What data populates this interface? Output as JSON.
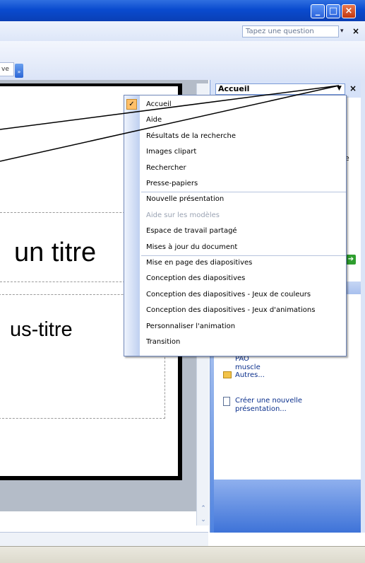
{
  "window": {
    "controls": {
      "minimize_icon": "_",
      "maximize_icon": "□",
      "close_icon": "×"
    }
  },
  "menubar": {
    "help_placeholder": "Tapez une question",
    "help_dropdown_icon": "▾",
    "close_icon": "×"
  },
  "toolbar": {
    "fragment_label": "ve",
    "overflow_icon": "»"
  },
  "slide": {
    "title_placeholder_fragment": "un titre",
    "subtitle_placeholder_fragment": "us-titre"
  },
  "scrollbar": {
    "up_icon": "⌃",
    "down_icon": "⌄"
  },
  "taskpane": {
    "title": "Accueil",
    "dropdown_icon": "▼",
    "close_icon": "×",
    "fragment_e": "e",
    "go_icon": "➔",
    "recent_files": [
      "PAO",
      "muscle"
    ],
    "more_label": "Autres...",
    "create_new_line1": "Créer une nouvelle",
    "create_new_line2": "présentation..."
  },
  "dropdown_menu": {
    "items": [
      {
        "label": "Accueil",
        "checked": true,
        "disabled": false
      },
      {
        "label": "Aide",
        "checked": false,
        "disabled": false
      },
      {
        "label": "Résultats de la recherche",
        "checked": false,
        "disabled": false
      },
      {
        "label": "Images clipart",
        "checked": false,
        "disabled": false
      },
      {
        "label": "Rechercher",
        "checked": false,
        "disabled": false
      },
      {
        "label": "Presse-papiers",
        "checked": false,
        "disabled": false
      },
      {
        "label": "Nouvelle présentation",
        "checked": false,
        "disabled": false
      },
      {
        "label": "Aide sur les modèles",
        "checked": false,
        "disabled": true
      },
      {
        "label": "Espace de travail partagé",
        "checked": false,
        "disabled": false
      },
      {
        "label": "Mises à jour du document",
        "checked": false,
        "disabled": false
      },
      {
        "label": "Mise en page des diapositives",
        "checked": false,
        "disabled": false
      },
      {
        "label": "Conception des diapositives",
        "checked": false,
        "disabled": false
      },
      {
        "label": "Conception des diapositives - Jeux de couleurs",
        "checked": false,
        "disabled": false
      },
      {
        "label": "Conception des diapositives - Jeux d'animations",
        "checked": false,
        "disabled": false
      },
      {
        "label": "Personnaliser l'animation",
        "checked": false,
        "disabled": false
      },
      {
        "label": "Transition",
        "checked": false,
        "disabled": false
      }
    ],
    "check_icon": "✓"
  },
  "colors": {
    "titlebar": "#0a4bcf",
    "checked_highlight": "#ffc06a",
    "taskpane_gradient": "#4f83e0"
  }
}
